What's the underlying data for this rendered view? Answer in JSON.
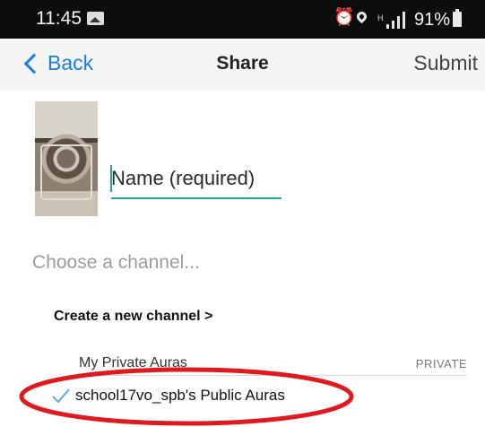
{
  "status_bar": {
    "time": "11:45",
    "battery": "91%",
    "icons": [
      "gallery-icon",
      "alarm-icon",
      "location-icon",
      "signal-icon",
      "battery-icon"
    ]
  },
  "nav": {
    "back_label": "Back",
    "title": "Share",
    "submit_label": "Submit",
    "accent_color": "#1a7de0"
  },
  "form": {
    "name_placeholder": "Name (required)",
    "name_value": "",
    "underline_color": "#20a79a"
  },
  "channels": {
    "heading": "Choose a channel...",
    "create_new": "Create a new channel >",
    "items": [
      {
        "name": "My Private Auras",
        "badge": "PRIVATE",
        "selected": false
      },
      {
        "name": "school17vo_spb's Public Auras",
        "badge": "",
        "selected": true
      }
    ]
  },
  "annotation": {
    "color": "#e0191f"
  }
}
